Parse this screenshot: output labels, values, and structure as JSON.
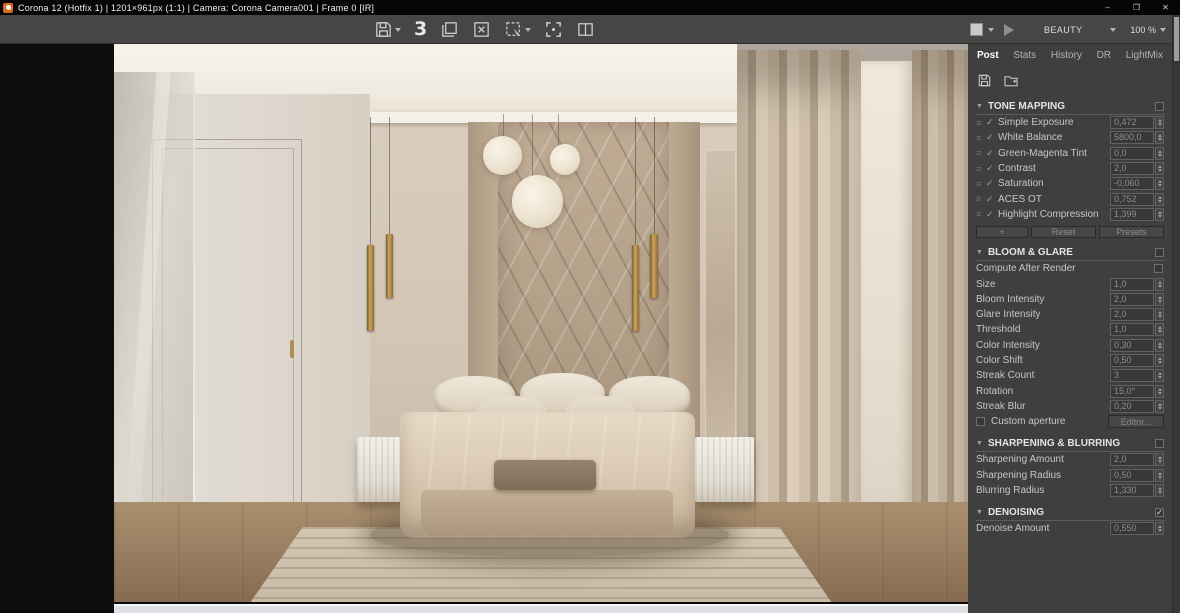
{
  "window": {
    "title": "Corona 12 (Hotfix 1) | 1201×961px (1:1) | Camera: Corona Camera001 | Frame 0 [IR]"
  },
  "icons": {
    "minimize": "–",
    "maximize": "❐",
    "close": "✕",
    "drag": "≡",
    "check": "✓",
    "collapse": "▼"
  },
  "toolbar": {
    "max_badge": "3",
    "render_element_label": "BEAUTY",
    "zoom_level": "100 %"
  },
  "panel": {
    "tabs": [
      {
        "label": "Post"
      },
      {
        "label": "Stats"
      },
      {
        "label": "History"
      },
      {
        "label": "DR"
      },
      {
        "label": "LightMix"
      }
    ],
    "tone_mapping": {
      "title": "TONE MAPPING",
      "rows": [
        {
          "label": "Simple Exposure",
          "value": "0,472"
        },
        {
          "label": "White Balance",
          "value": "5800,0"
        },
        {
          "label": "Green-Magenta Tint",
          "value": "0,0"
        },
        {
          "label": "Contrast",
          "value": "2,0"
        },
        {
          "label": "Saturation",
          "value": "-0,060"
        },
        {
          "label": "ACES OT",
          "value": "0,752"
        },
        {
          "label": "Highlight Compression",
          "value": "1,399"
        }
      ],
      "buttons": {
        "add": "+",
        "reset": "Reset",
        "presets": "Presets"
      }
    },
    "bloom_glare": {
      "title": "BLOOM & GLARE",
      "compute_label": "Compute After Render",
      "rows": [
        {
          "label": "Size",
          "value": "1,0"
        },
        {
          "label": "Bloom Intensity",
          "value": "2,0"
        },
        {
          "label": "Glare Intensity",
          "value": "2,0"
        },
        {
          "label": "Threshold",
          "value": "1,0"
        },
        {
          "label": "Color Intensity",
          "value": "0,30"
        },
        {
          "label": "Color Shift",
          "value": "0,50"
        },
        {
          "label": "Streak Count",
          "value": "3"
        },
        {
          "label": "Rotation",
          "value": "15,0°"
        },
        {
          "label": "Streak Blur",
          "value": "0,20"
        }
      ],
      "custom_aperture_label": "Custom aperture",
      "editor_button": "Editor..."
    },
    "sharpening": {
      "title": "SHARPENING & BLURRING",
      "rows": [
        {
          "label": "Sharpening Amount",
          "value": "2,0"
        },
        {
          "label": "Sharpening Radius",
          "value": "0,50"
        },
        {
          "label": "Blurring Radius",
          "value": "1,330"
        }
      ]
    },
    "denoising": {
      "title": "DENOISING",
      "rows": [
        {
          "label": "Denoise Amount",
          "value": "0,550"
        }
      ]
    }
  },
  "colors": {
    "corona_accent": "#d86b26",
    "toolbar_bg": "#464646",
    "panel_bg": "#3f3f3f",
    "viewport_bg": "#0d0d0d",
    "scrollbar_light": "#dde1e5"
  }
}
